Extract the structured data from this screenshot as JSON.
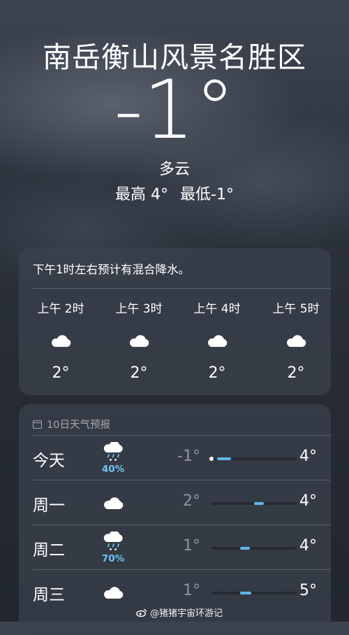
{
  "header": {
    "location": "南岳衡山风景名胜区",
    "temperature": "-1°",
    "condition": "多云",
    "high": "最高 4°",
    "low": "最低-1°"
  },
  "hourly": {
    "note": "下午1时左右预计有混合降水。",
    "items": [
      {
        "time": "上午 2时",
        "icon": "cloud-icon",
        "temp": "2°"
      },
      {
        "time": "上午 3时",
        "icon": "cloud-icon",
        "temp": "2°"
      },
      {
        "time": "上午 4时",
        "icon": "cloud-icon",
        "temp": "2°"
      },
      {
        "time": "上午 5时",
        "icon": "cloud-icon",
        "temp": "2°"
      }
    ]
  },
  "daily": {
    "title": "10日天气预报",
    "range": [
      -1,
      5
    ],
    "current": -1,
    "days": [
      {
        "name": "今天",
        "icon": "cloud-rain-snow-icon",
        "precip": "40%",
        "low": "-1°",
        "high": "4°",
        "low_val": -1,
        "high_val": 4
      },
      {
        "name": "周一",
        "icon": "cloud-icon",
        "precip": "",
        "low": "2°",
        "high": "4°",
        "low_val": 2,
        "high_val": 4
      },
      {
        "name": "周二",
        "icon": "cloud-rain-snow-icon",
        "precip": "70%",
        "low": "1°",
        "high": "4°",
        "low_val": 1,
        "high_val": 4
      },
      {
        "name": "周三",
        "icon": "cloud-icon",
        "precip": "",
        "low": "1°",
        "high": "5°",
        "low_val": 1,
        "high_val": 5
      }
    ]
  },
  "watermark": {
    "text": "@猪猪宇宙环游记"
  },
  "colors": {
    "accent": "#5fb8ea",
    "precip": "#6cc4f2"
  }
}
